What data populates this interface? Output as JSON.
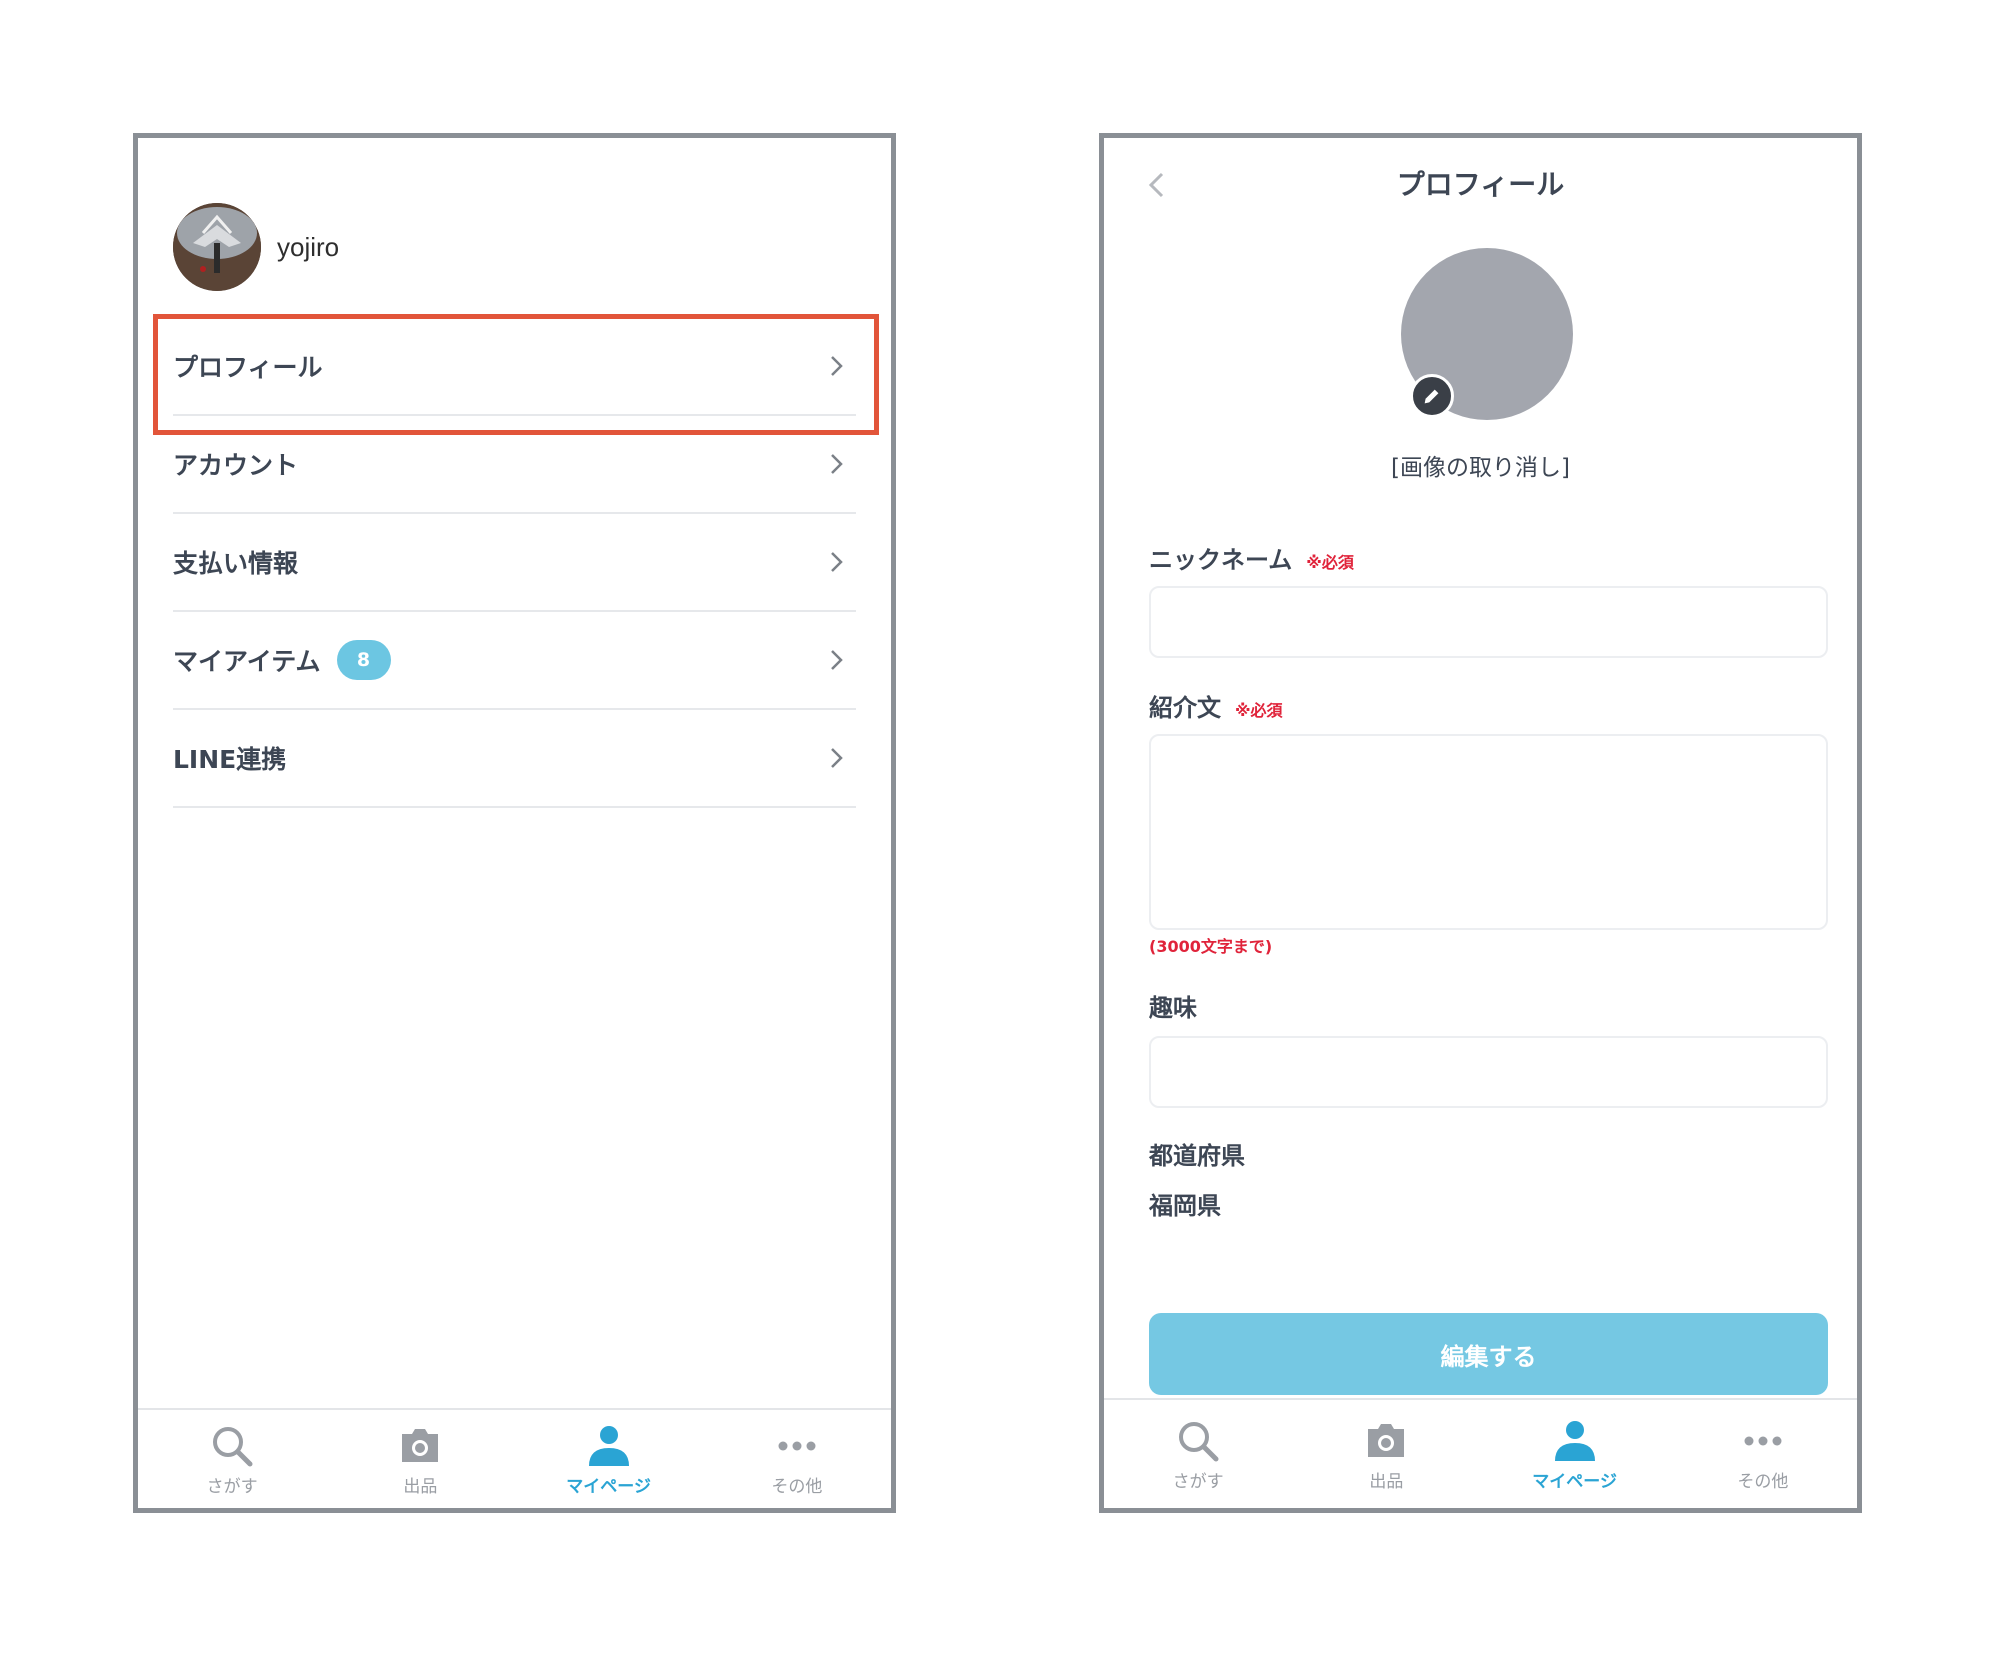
{
  "left": {
    "username": "yojiro",
    "menu_items": [
      {
        "label": "プロフィール"
      },
      {
        "label": "アカウント"
      },
      {
        "label": "支払い情報"
      },
      {
        "label": "マイアイテム",
        "badge": "8"
      },
      {
        "label": "LINE連携"
      }
    ],
    "highlight_color": "#e2553a"
  },
  "nav": {
    "search": "さがす",
    "sell": "出品",
    "mypage": "マイページ",
    "other": "その他"
  },
  "right": {
    "title": "プロフィール",
    "cancel_image": "[画像の取り消し]",
    "nickname_label": "ニックネーム",
    "intro_label": "紹介文",
    "required": "※必須",
    "intro_limit": "(3000文字まで)",
    "hobby_label": "趣味",
    "prefecture_label": "都道府県",
    "prefecture_value": "福岡県",
    "submit": "編集する"
  },
  "colors": {
    "accent": "#2aa4d4",
    "button": "#75c8e3",
    "badge": "#6cc6e2",
    "required": "#e0233a"
  }
}
